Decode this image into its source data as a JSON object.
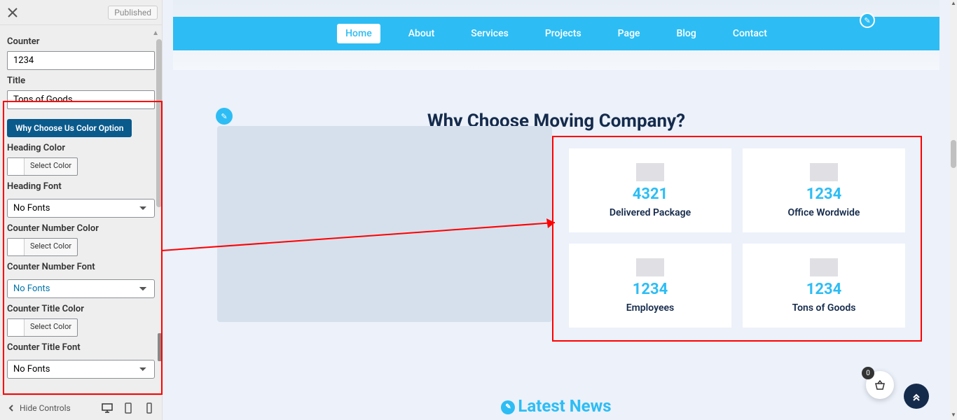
{
  "sidebar": {
    "publish": "Published",
    "counter_label": "Counter",
    "counter_value": "1234",
    "title_label": "Title",
    "title_value": "Tons of Goods",
    "section_header": "Why Choose Us Color Option",
    "heading_color_label": "Heading Color",
    "heading_font_label": "Heading Font",
    "heading_font_value": "No Fonts",
    "counter_number_color_label": "Counter Number Color",
    "counter_number_font_label": "Counter Number Font",
    "counter_number_font_value": "No Fonts",
    "counter_title_color_label": "Counter Title Color",
    "counter_title_font_label": "Counter Title Font",
    "counter_title_font_value": "No Fonts",
    "select_color": "Select Color",
    "hide_controls": "Hide Controls"
  },
  "nav": {
    "items": [
      "Home",
      "About",
      "Services",
      "Projects",
      "Page",
      "Blog",
      "Contact"
    ],
    "active_index": 0
  },
  "heading": "Why Choose Moving Company?",
  "counters": [
    {
      "value": "4321",
      "title": "Delivered Package"
    },
    {
      "value": "1234",
      "title": "Office Wordwide"
    },
    {
      "value": "1234",
      "title": "Employees"
    },
    {
      "value": "1234",
      "title": "Tons of Goods"
    }
  ],
  "latest_news": "Latest News",
  "cart_count": "0"
}
